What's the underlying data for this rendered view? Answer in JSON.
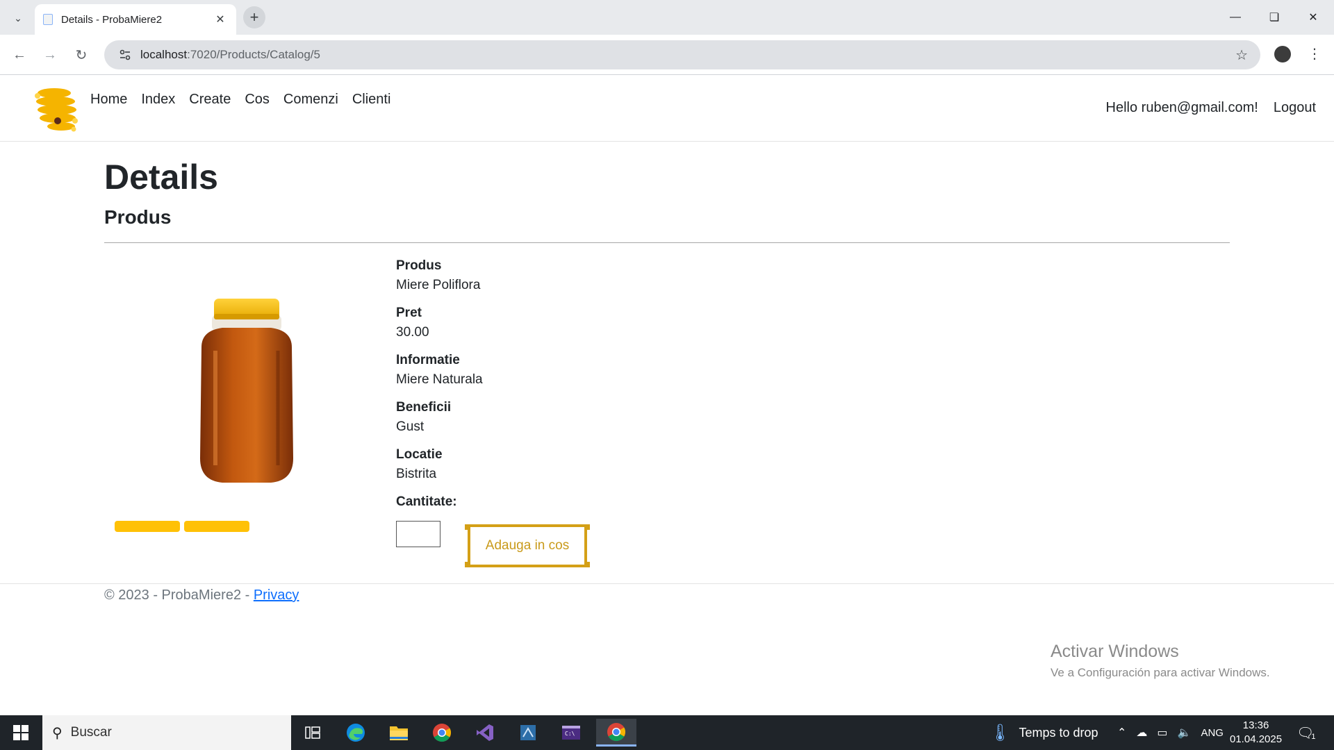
{
  "browser": {
    "tab_title": "Details - ProbaMiere2",
    "url_host": "localhost",
    "url_path": ":7020/Products/Catalog/5"
  },
  "site": {
    "nav": [
      "Home",
      "Index",
      "Create",
      "Cos",
      "Comenzi",
      "Clienti"
    ],
    "greeting": "Hello ruben@gmail.com!",
    "logout": "Logout"
  },
  "page": {
    "title": "Details",
    "subtitle": "Produs",
    "fields": [
      {
        "label": "Produs",
        "value": "Miere Poliflora"
      },
      {
        "label": "Pret",
        "value": "30.00"
      },
      {
        "label": "Informatie",
        "value": "Miere Naturala"
      },
      {
        "label": "Beneficii",
        "value": "Gust"
      },
      {
        "label": "Locatie",
        "value": "Bistrita"
      }
    ],
    "quantity_label": "Cantitate:",
    "quantity_value": "",
    "add_button": "Adauga in cos"
  },
  "footer": {
    "text": "© 2023 - ProbaMiere2 - ",
    "privacy": "Privacy"
  },
  "watermark": {
    "line1": "Activar Windows",
    "line2": "Ve a Configuración para activar Windows."
  },
  "taskbar": {
    "search_placeholder": "Buscar",
    "weather": "Temps to drop",
    "language": "ANG",
    "time": "13:36",
    "date": "01.04.2025",
    "notifications": "1"
  },
  "colors": {
    "accent_yellow": "#ffc107",
    "button_gold": "#d4a017",
    "link_blue": "#0d6efd"
  }
}
